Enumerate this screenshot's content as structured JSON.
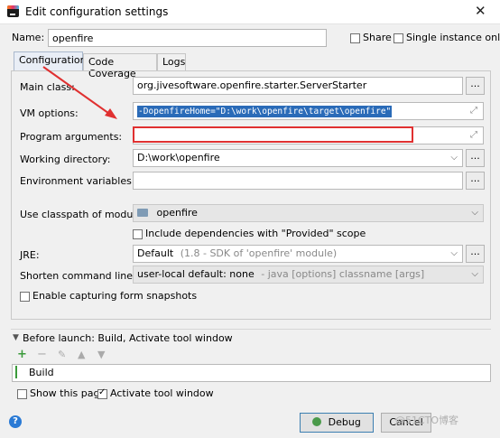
{
  "window": {
    "title": "Edit configuration settings",
    "close_glyph": "✕"
  },
  "name_row": {
    "label": "Name:",
    "value": "openfire",
    "share_label": "Share",
    "single_instance_label": "Single instance only"
  },
  "tabs": [
    {
      "label": "Configuration"
    },
    {
      "label": "Code Coverage"
    },
    {
      "label": "Logs"
    }
  ],
  "form": {
    "main_class_label": "Main class:",
    "main_class_value": "org.jivesoftware.openfire.starter.ServerStarter",
    "vm_options_label": "VM options:",
    "vm_options_value": "-DopenfireHome=\"D:\\work\\openfire\\target\\openfire\"",
    "program_args_label": "Program arguments:",
    "program_args_value": "",
    "working_dir_label": "Working directory:",
    "working_dir_value": "D:\\work\\openfire",
    "env_vars_label": "Environment variables:",
    "classpath_label": "Use classpath of module:",
    "classpath_value": "openfire",
    "include_deps_label": "Include dependencies with \"Provided\" scope",
    "jre_label": "JRE:",
    "jre_value": "Default",
    "jre_detail": "(1.8 - SDK of 'openfire' module)",
    "shorten_label": "Shorten command line:",
    "shorten_value": "user-local default: none",
    "shorten_detail": "- java [options] classname [args]",
    "snapshots_label": "Enable capturing form snapshots",
    "dots": "..."
  },
  "before_launch": {
    "header": "Before launch: Build, Activate tool window",
    "item": "Build"
  },
  "bottom": {
    "show_page_label": "Show this page",
    "activate_label": "Activate tool window",
    "help": "?",
    "debug_label": "Debug",
    "cancel_label": "Cancel"
  },
  "watermark": "@51CTO博客",
  "colors": {
    "selection": "#2a6bb8",
    "highlight_box": "#e03030",
    "arrow": "#e03030",
    "add": "#3a9a3a"
  },
  "icons": {
    "app": "intellij-icon",
    "folder": "module-folder-icon",
    "bug": "debug-bug-icon"
  }
}
